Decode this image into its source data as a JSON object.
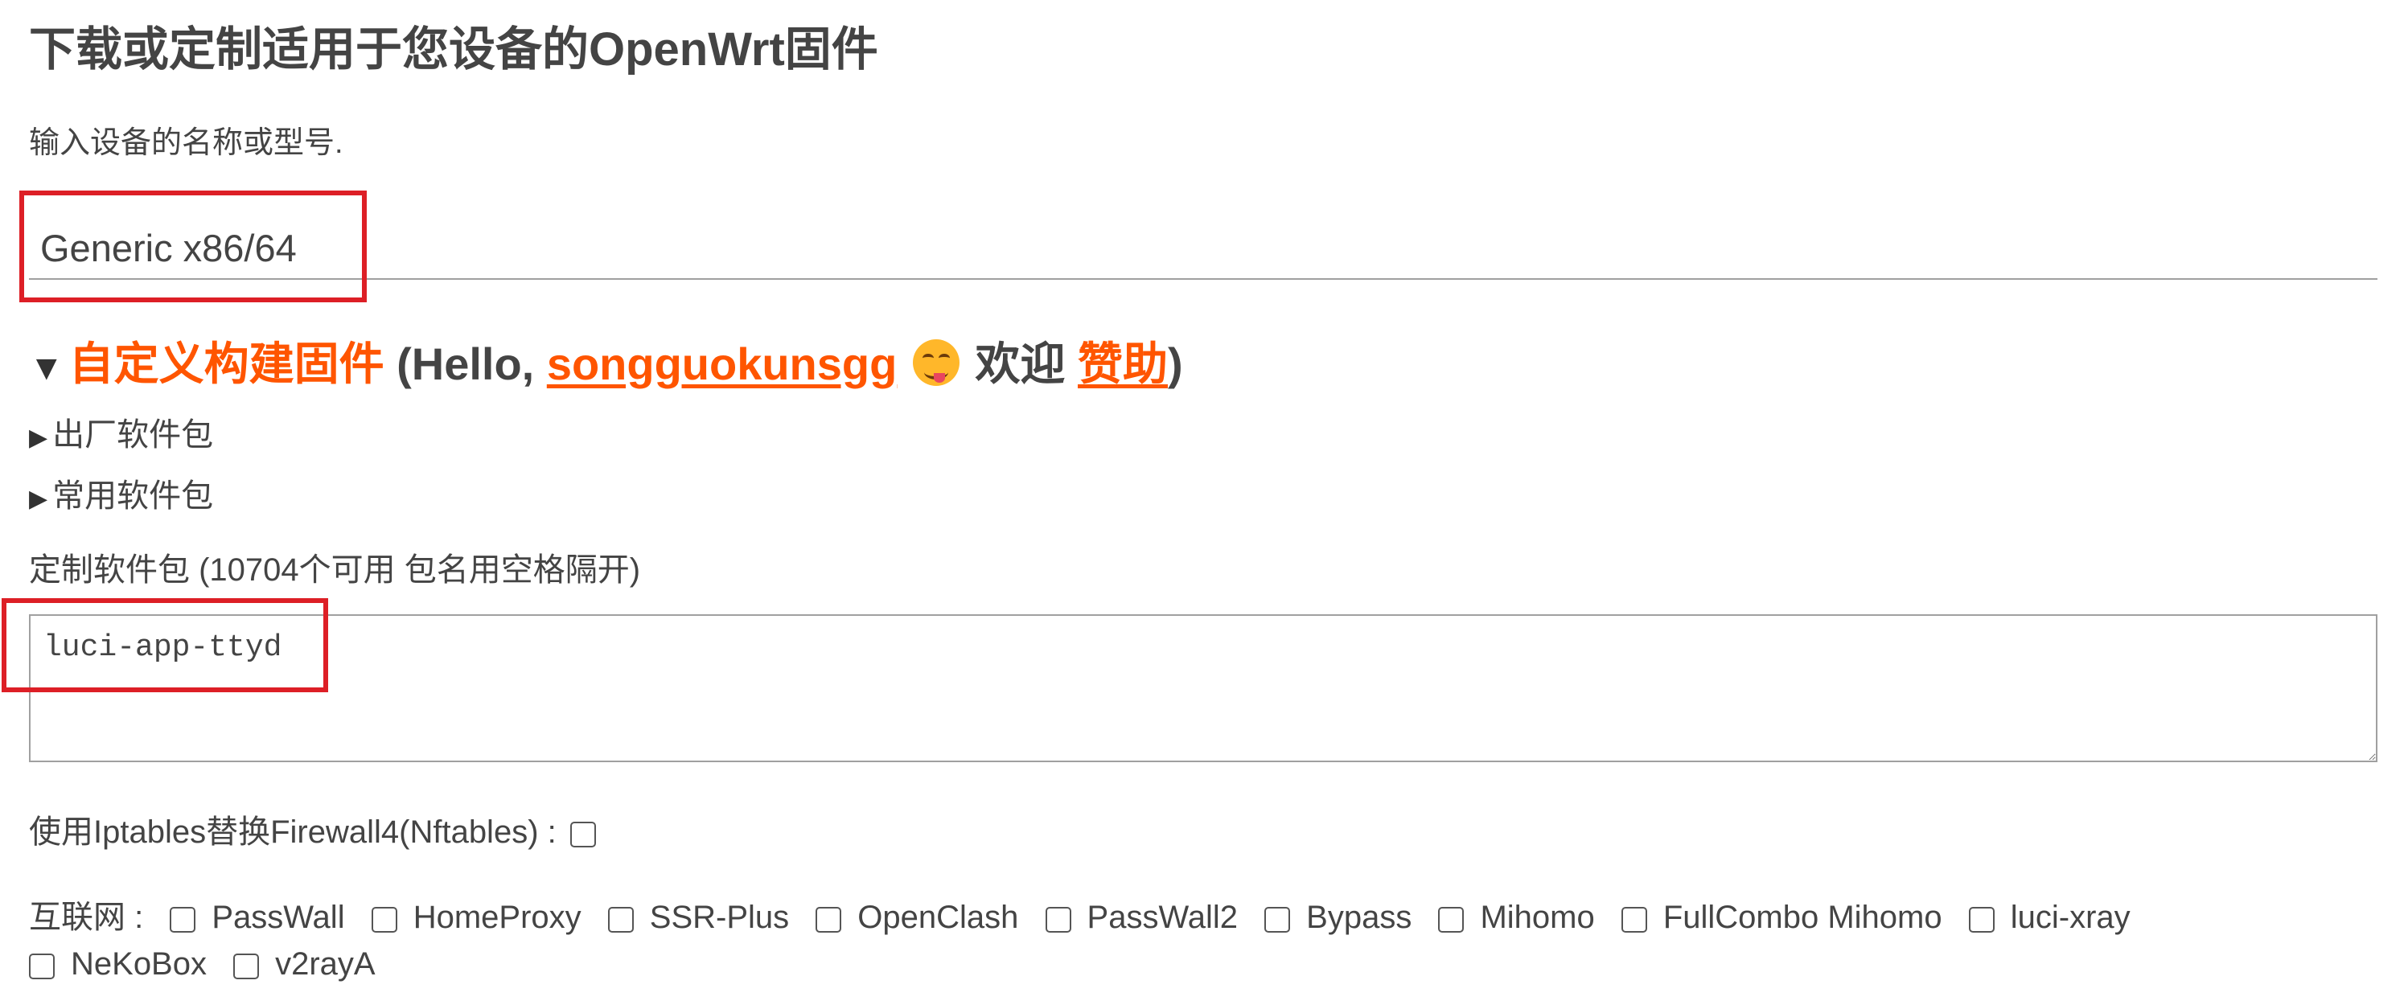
{
  "page": {
    "title": "下载或定制适用于您设备的OpenWrt固件",
    "device_hint": "输入设备的名称或型号."
  },
  "device_search": {
    "value": "Generic x86/64"
  },
  "custom_build": {
    "heading": "自定义构建固件",
    "greeting_prefix": "(Hello,",
    "username": "songguokunsgg",
    "emoji": "smiling-face-with-tongue",
    "welcome": "欢迎",
    "sponsor_link": "赞助",
    "close_paren": ")"
  },
  "sections": {
    "factory_packages": "出厂软件包",
    "common_packages": "常用软件包"
  },
  "packages": {
    "label": "定制软件包 (10704个可用 包名用空格隔开)",
    "value": "luci-app-ttyd"
  },
  "firewall": {
    "label": "使用Iptables替换Firewall4(Nftables) :",
    "checked": false
  },
  "internet": {
    "label": "互联网 :",
    "options": [
      {
        "label": "PassWall",
        "checked": false
      },
      {
        "label": "HomeProxy",
        "checked": false
      },
      {
        "label": "SSR-Plus",
        "checked": false
      },
      {
        "label": "OpenClash",
        "checked": false
      },
      {
        "label": "PassWall2",
        "checked": false
      },
      {
        "label": "Bypass",
        "checked": false
      },
      {
        "label": "Mihomo",
        "checked": false
      },
      {
        "label": "FullCombo Mihomo",
        "checked": false
      },
      {
        "label": "luci-xray",
        "checked": false
      },
      {
        "label": "NeKoBox",
        "checked": false
      },
      {
        "label": "v2rayA",
        "checked": false
      }
    ]
  },
  "colors": {
    "accent": "#ff5500",
    "text": "#444444",
    "highlight_box": "#dd1f26"
  }
}
